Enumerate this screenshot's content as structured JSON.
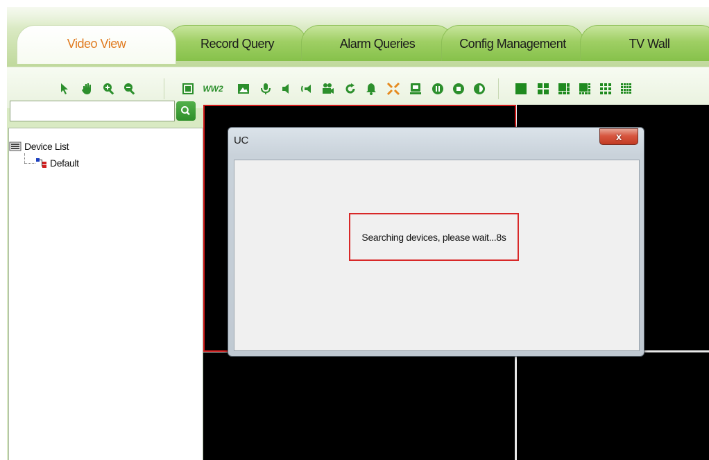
{
  "tabs": [
    {
      "label": "Video View",
      "active": true
    },
    {
      "label": "Record Query",
      "active": false
    },
    {
      "label": "Alarm Queries",
      "active": false
    },
    {
      "label": "Config Management",
      "active": false
    },
    {
      "label": "TV Wall",
      "active": false
    }
  ],
  "toolbar": {
    "tools": [
      "pointer-icon",
      "hand-icon",
      "zoom-in-icon",
      "zoom-out-icon"
    ],
    "controls": [
      "fullscreen-icon",
      "ww2-icon",
      "snapshot-icon",
      "microphone-icon",
      "speaker-icon",
      "broadcast-icon",
      "record-icon",
      "refresh-icon",
      "alarm-bell-icon",
      "shrink-icon",
      "monitor-icon",
      "circle-pause-icon",
      "circle-stop-icon",
      "circle-half-icon"
    ],
    "ww2_label": "WW2",
    "layouts": [
      "layout-1-icon",
      "layout-4-icon",
      "layout-6-icon",
      "layout-8-icon",
      "layout-9-icon",
      "layout-16-icon"
    ],
    "accent_color": "#2c8f2c"
  },
  "sidebar": {
    "search": {
      "value": "",
      "placeholder": ""
    },
    "tree": {
      "root": "Device List",
      "children": [
        "Default"
      ]
    }
  },
  "dialog": {
    "title": "UC",
    "close_label": "x",
    "message": "Searching devices, please wait...8s"
  }
}
